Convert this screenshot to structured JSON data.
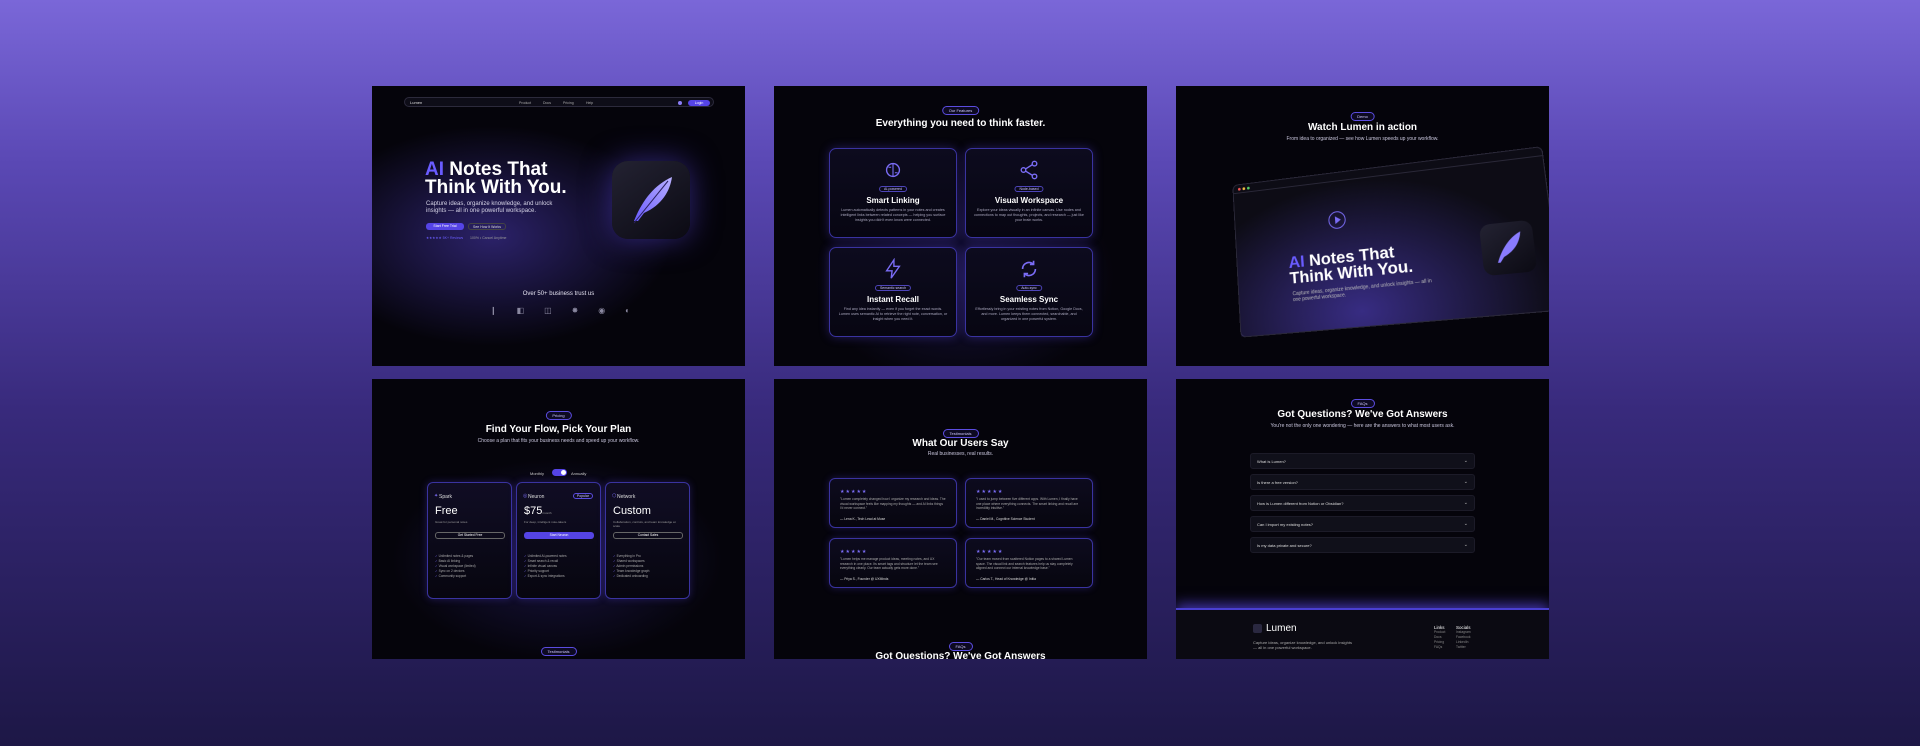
{
  "panel1": {
    "nav": {
      "logo": "Lumen",
      "links": [
        "Product",
        "Docs",
        "Pricing",
        "Help"
      ],
      "login": "Login"
    },
    "hero": {
      "ai": "AI",
      "title_rest": "Notes That",
      "title_line2": "Think With You.",
      "subtitle": "Capture ideas, organize knowledge, and unlock insights — all in one powerful workspace.",
      "primary_button": "Start Free Trial",
      "secondary_button": "See How It Works",
      "rating": "★★★★★ 5K+ Reviews",
      "secondary_note": "100% • Cancel Anytime"
    },
    "trust": "Over 50+ business trust us"
  },
  "panel2": {
    "pill": "Our Features",
    "title": "Everything you need to think faster.",
    "cards": [
      {
        "tag": "AI-powered",
        "title": "Smart Linking",
        "desc": "Lumen automatically detects patterns in your notes and creates intelligent links between related concepts — helping you surface insights you didn't even know were connected."
      },
      {
        "tag": "Node-based",
        "title": "Visual Workspace",
        "desc": "Explore your ideas visually in an infinite canvas. Use nodes and connections to map out thoughts, projects, and research — just like your brain works."
      },
      {
        "tag": "Semantic search",
        "title": "Instant Recall",
        "desc": "Find any idea instantly — even if you forget the exact words. Lumen uses semantic AI to retrieve the right note, conversation, or insight when you need it."
      },
      {
        "tag": "Auto-sync",
        "title": "Seamless Sync",
        "desc": "Effortlessly bring in your existing notes from Notion, Google Docs, and more. Lumen keeps them connected, searchable, and organized in one powerful system."
      }
    ]
  },
  "panel3": {
    "pill": "Demo",
    "title": "Watch Lumen in action",
    "subtitle": "From idea to organized — see how Lumen speeds up your workflow.",
    "browser_logo": "Lumen",
    "hero_ai": "AI",
    "hero_rest": "Notes That",
    "hero_line2": "Think With You.",
    "hero_sub": "Capture ideas, organize knowledge, and unlock insights — all in one powerful workspace."
  },
  "panel4": {
    "pill": "Pricing",
    "title": "Find Your Flow, Pick Your Plan",
    "subtitle": "Choose a plan that fits your business needs and speed up your workflow.",
    "toggle": {
      "monthly": "Monthly",
      "annually": "Annually"
    },
    "plans": [
      {
        "name": "Spark",
        "price": "Free",
        "desc": "Great for personal notes",
        "button": "Get Started Free",
        "features": [
          "Unlimited notes & pages",
          "Basic AI linking",
          "Visual workspace (limited)",
          "Sync on 2 devices",
          "Community support"
        ]
      },
      {
        "name": "Neuron",
        "badge": "Popular",
        "price": "$75",
        "price_unit": "/month",
        "desc": "For deep, intelligent note-takers",
        "button": "Start Neuron",
        "features": [
          "Unlimited AI-powered notes",
          "Smart search & recall",
          "Infinite visual canvas",
          "Priority support",
          "Export & sync integrations"
        ]
      },
      {
        "name": "Network",
        "price": "Custom",
        "desc": "Collaboration, controls, and team knowledge at scale",
        "button": "Contact Sales",
        "features": [
          "Everything in Pro",
          "Shared workspaces",
          "Admin permissions",
          "Team knowledge graph",
          "Dedicated onboarding"
        ]
      }
    ],
    "next_pill": "Testimonials"
  },
  "panel5": {
    "pill": "Testimonials",
    "title": "What Our Users Say",
    "subtitle": "Real businesses, real results.",
    "testimonials": [
      {
        "stars": "★★★★★",
        "quote": "\"Lumen completely changed how I organize my research and ideas. The visual workspace feels like mapping my thoughts — and AI links things I'd never connect.\"",
        "author": "— Lena K., Tech Lead at Muse"
      },
      {
        "stars": "★★★★★",
        "quote": "\"I used to jump between five different apps. With Lumen, I finally have one place where everything connects. The smart linking and recall are incredibly intuitive.\"",
        "author": "— Daniel M., Cognitive Science Student"
      },
      {
        "stars": "★★★★★",
        "quote": "\"Lumen helps me manage product ideas, meeting notes, and UX research in one place. Its smart tags and structure let the team see everything clearly. Our team actually gets more done.\"",
        "author": "— Priya S., Founder @ UXMinds"
      },
      {
        "stars": "★★★★★",
        "quote": "\"Our team moved from scattered Notion pages to a shared Lumen space. The visual link and search features help us stay completely aligned and connect our internal knowledge base.\"",
        "author": "— Carlos T., Head of Knowledge @ Initia"
      }
    ],
    "next_pill": "FAQs",
    "next_title": "Got Questions? We've Got Answers"
  },
  "panel6": {
    "pill": "FAQs",
    "title": "Got Questions? We've Got Answers",
    "subtitle": "You're not the only one wondering — here are the answers to what most users ask.",
    "faqs": [
      "What is Lumen?",
      "Is there a free version?",
      "How is Lumen different from Notion or Obsidian?",
      "Can I import my existing notes?",
      "Is my data private and secure?"
    ],
    "footer": {
      "logo": "Lumen",
      "desc": "Capture ideas, organize knowledge, and unlock insights — all in one powerful workspace.",
      "links_title": "Links",
      "links": [
        "Product",
        "Docs",
        "Pricing",
        "FAQs"
      ],
      "socials_title": "Socials",
      "socials": [
        "Instagram",
        "Facebook",
        "LinkedIn",
        "Twitter"
      ]
    }
  },
  "colors": {
    "accent": "#5544e6",
    "accent_light": "#7a6cf5",
    "panel_bg": "#05040b"
  }
}
